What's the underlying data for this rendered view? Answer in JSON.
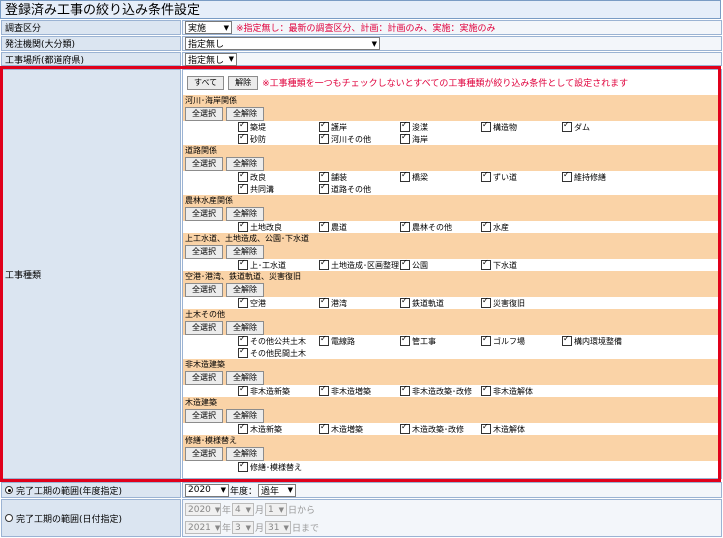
{
  "title": "登録済み工事の絞り込み条件設定",
  "fields": {
    "survey_label": "調査区分",
    "survey_value": "実施",
    "survey_note": "※指定無し：最新の調査区分、計画：計画のみ、実施：実施のみ",
    "agency_label": "発注機関(大分類)",
    "agency_value": "指定無し",
    "location_label": "工事場所(都道府県)",
    "location_value": "指定無し",
    "kind_label": "工事種類"
  },
  "kind_panel": {
    "all_label": "すべて",
    "clear_label": "解除",
    "note": "※工事種類を一つもチェックしないとすべての工事種類が絞り込み条件として設定されます",
    "group_select_all": "全選択",
    "group_clear_all": "全解除",
    "groups": [
      {
        "name": "河川･海岸関係",
        "items": [
          "築堤",
          "護岸",
          "浚渫",
          "構造物",
          "ダム",
          "砂防",
          "河川その他",
          "海岸"
        ]
      },
      {
        "name": "道路関係",
        "items": [
          "改良",
          "舗装",
          "橋梁",
          "ずい道",
          "維持修繕",
          "共同溝",
          "道路その他"
        ]
      },
      {
        "name": "農林水産関係",
        "items": [
          "土地改良",
          "農道",
          "農林その他",
          "水産"
        ]
      },
      {
        "name": "上工水道、土地造成、公園･下水道",
        "items": [
          "上･工水道",
          "土地造成･区画整理",
          "公園",
          "下水道"
        ]
      },
      {
        "name": "空港･港湾、鉄道軌道、災害復旧",
        "items": [
          "空港",
          "港湾",
          "鉄道軌道",
          "災害復旧"
        ]
      },
      {
        "name": "土木その他",
        "items": [
          "その他公共土木",
          "電線路",
          "管工事",
          "ゴルフ場",
          "構内環境整備",
          "その他民間土木"
        ]
      },
      {
        "name": "非木造建築",
        "items": [
          "非木造新築",
          "非木造増築",
          "非木造改築･改修",
          "非木造解体"
        ]
      },
      {
        "name": "木造建築",
        "items": [
          "木造新築",
          "木造増築",
          "木造改築･改修",
          "木造解体"
        ]
      },
      {
        "name": "修繕･模様替え",
        "items": [
          "修繕･模様替え"
        ]
      }
    ]
  },
  "period_year": {
    "label": "完了工期の範囲(年度指定)",
    "year": "2020",
    "year_suffix": "年度：",
    "range": "過年"
  },
  "period_date": {
    "label": "完了工期の範囲(日付指定)",
    "from_year": "2020",
    "from_month": "4",
    "from_day": "1",
    "to_year": "2021",
    "to_month": "3",
    "to_day": "31",
    "year_unit": "年",
    "month_unit": "月",
    "day_from": "日から",
    "day_to": "日まで"
  }
}
